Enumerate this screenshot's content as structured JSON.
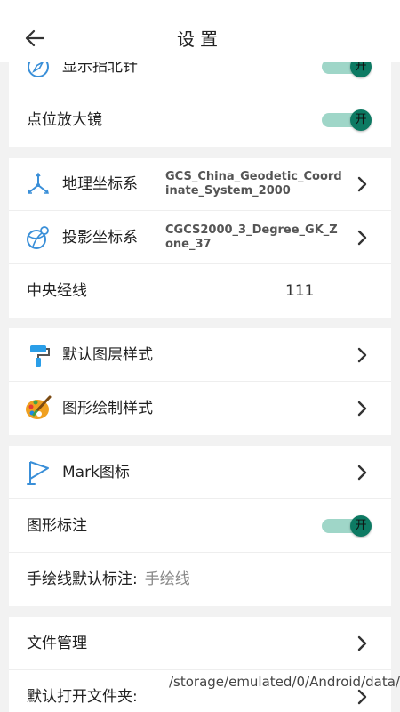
{
  "header": {
    "title": "设置"
  },
  "display": {
    "compass_label": "显示指北针",
    "compass_toggle": "开",
    "magnifier_label": "点位放大镜",
    "magnifier_toggle": "开"
  },
  "coordinates": {
    "geo_label": "地理坐标系",
    "geo_value": "GCS_China_Geodetic_Coordinate_System_2000",
    "proj_label": "投影坐标系",
    "proj_value": "CGCS2000_3_Degree_GK_Zone_37",
    "meridian_label": "中央经线",
    "meridian_value": "111"
  },
  "styles": {
    "layer_style_label": "默认图层样式",
    "shape_style_label": "图形绘制样式"
  },
  "marks": {
    "mark_icon_label": "Mark图标",
    "shape_annot_label": "图形标注",
    "shape_annot_toggle": "开",
    "freehand_label": "手绘线默认标注:",
    "freehand_value": "手绘线"
  },
  "files": {
    "file_mgmt_label": "文件管理",
    "default_folder_label": "默认打开文件夹:",
    "default_folder_value": "/storage/emulated/0/Android/data/"
  },
  "colors": {
    "accent": "#0d7a63",
    "track": "#9fd6c8",
    "icon_blue": "#3a8fd8"
  }
}
